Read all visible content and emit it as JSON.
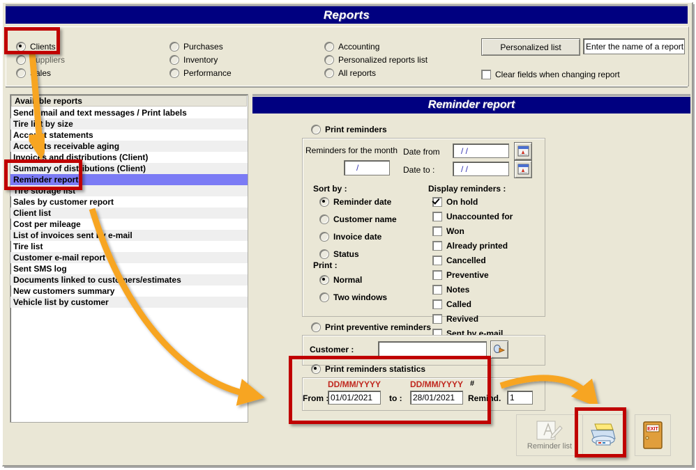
{
  "window": {
    "title": "Reports"
  },
  "categories": {
    "col1": [
      {
        "label": "Clients",
        "selected": true,
        "dim": false
      },
      {
        "label": "Suppliers",
        "selected": false,
        "dim": true
      },
      {
        "label": "Sales",
        "selected": false,
        "dim": false
      }
    ],
    "col2": [
      {
        "label": "Purchases",
        "selected": false
      },
      {
        "label": "Inventory",
        "selected": false
      },
      {
        "label": "Performance",
        "selected": false
      }
    ],
    "col3": [
      {
        "label": "Accounting",
        "selected": false
      },
      {
        "label": "Personalized reports list",
        "selected": false
      },
      {
        "label": "All reports",
        "selected": false
      }
    ]
  },
  "header_tools": {
    "personalized_list_button": "Personalized list",
    "report_name_value": "Enter the name of a report",
    "clear_fields_label": "Clear fields when changing report",
    "clear_fields_checked": false
  },
  "available_reports": {
    "header": "Available reports",
    "items": [
      {
        "label": "Send email and text messages / Print labels",
        "selected": false
      },
      {
        "label": "Tire list by size",
        "selected": false
      },
      {
        "label": "Account statements",
        "selected": false
      },
      {
        "label": "Accounts receivable aging",
        "selected": false
      },
      {
        "label": "Invoices and distributions (Client)",
        "selected": false
      },
      {
        "label": "Summary of distributions (Client)",
        "selected": false
      },
      {
        "label": "Reminder report",
        "selected": true
      },
      {
        "label": "Tire storage list",
        "selected": false
      },
      {
        "label": "Sales by customer report",
        "selected": false
      },
      {
        "label": "Client list",
        "selected": false
      },
      {
        "label": "Cost per mileage",
        "selected": false
      },
      {
        "label": "List of invoices sent by e-mail",
        "selected": false
      },
      {
        "label": "Tire list",
        "selected": false
      },
      {
        "label": "Customer e-mail report",
        "selected": false
      },
      {
        "label": "Sent SMS log",
        "selected": false
      },
      {
        "label": "Documents linked to customers/estimates",
        "selected": false
      },
      {
        "label": "New customers summary",
        "selected": false
      },
      {
        "label": "Vehicle list by customer",
        "selected": false
      }
    ]
  },
  "report": {
    "title": "Reminder report",
    "mode_print_reminders": {
      "label": "Print reminders",
      "selected": false
    },
    "mode_preventive": {
      "label": "Print preventive reminders",
      "selected": false
    },
    "mode_statistics": {
      "label": "Print reminders statistics",
      "selected": true
    },
    "reminders_month": {
      "label": "Reminders for the month",
      "value": "/"
    },
    "date_from": {
      "label": "Date from",
      "value": "/ /"
    },
    "date_to": {
      "label": "Date to :",
      "value": "/ /"
    },
    "sort_by": {
      "label": "Sort by :",
      "options": [
        {
          "label": "Reminder date",
          "selected": true
        },
        {
          "label": "Customer name",
          "selected": false
        },
        {
          "label": "Invoice date",
          "selected": false
        },
        {
          "label": "Status",
          "selected": false
        }
      ]
    },
    "print": {
      "label": "Print :",
      "options": [
        {
          "label": "Normal",
          "selected": true
        },
        {
          "label": "Two windows",
          "selected": false
        }
      ]
    },
    "display_reminders": {
      "label": "Display reminders :",
      "options": [
        {
          "label": "On hold",
          "checked": true
        },
        {
          "label": "Unaccounted for",
          "checked": false
        },
        {
          "label": "Won",
          "checked": false
        },
        {
          "label": "Already printed",
          "checked": false
        },
        {
          "label": "Cancelled",
          "checked": false
        },
        {
          "label": "Preventive",
          "checked": false
        },
        {
          "label": "Notes",
          "checked": false
        },
        {
          "label": "Called",
          "checked": false
        },
        {
          "label": "Revived",
          "checked": false
        },
        {
          "label": "Sent by e-mail",
          "checked": false
        }
      ]
    },
    "customer": {
      "label": "Customer :",
      "value": ""
    },
    "statistics": {
      "format_hint_from": "DD/MM/YYYY",
      "format_hint_to": "DD/MM/YYYY",
      "from_label": "From :",
      "from_value": "01/01/2021",
      "to_label": "to :",
      "to_value": "28/01/2021",
      "count_label_line1": "#",
      "count_label_line2": "Remind.",
      "count_value": "1"
    }
  },
  "bottom_buttons": [
    {
      "name": "reminder-list",
      "label": "Reminder list"
    },
    {
      "name": "print",
      "label": ""
    },
    {
      "name": "exit",
      "label": "EXIT"
    }
  ],
  "colors": {
    "titlebar": "#000080",
    "panel_bg": "#EAE7D6",
    "selection": "#7B7BF5",
    "annotation_red": "#C00000",
    "annotation_orange": "#F7A521",
    "hint_red": "#C0281E"
  }
}
